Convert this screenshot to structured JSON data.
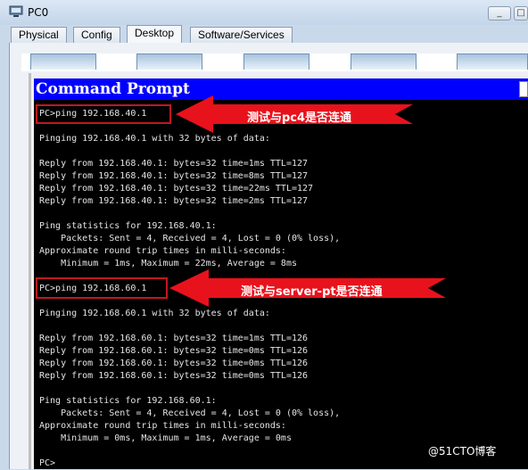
{
  "window": {
    "title": "PC0",
    "minimize": "_",
    "restore": "□"
  },
  "tabs": [
    {
      "label": "Physical"
    },
    {
      "label": "Config"
    },
    {
      "label": "Desktop"
    },
    {
      "label": "Software/Services"
    }
  ],
  "command_prompt": {
    "title": "Command Prompt"
  },
  "terminal": {
    "lines": [
      "PC>ping 192.168.40.1",
      "",
      "Pinging 192.168.40.1 with 32 bytes of data:",
      "",
      "Reply from 192.168.40.1: bytes=32 time=1ms TTL=127",
      "Reply from 192.168.40.1: bytes=32 time=8ms TTL=127",
      "Reply from 192.168.40.1: bytes=32 time=22ms TTL=127",
      "Reply from 192.168.40.1: bytes=32 time=2ms TTL=127",
      "",
      "Ping statistics for 192.168.40.1:",
      "    Packets: Sent = 4, Received = 4, Lost = 0 (0% loss),",
      "Approximate round trip times in milli-seconds:",
      "    Minimum = 1ms, Maximum = 22ms, Average = 8ms",
      "",
      "PC>ping 192.168.60.1",
      "",
      "Pinging 192.168.60.1 with 32 bytes of data:",
      "",
      "Reply from 192.168.60.1: bytes=32 time=1ms TTL=126",
      "Reply from 192.168.60.1: bytes=32 time=0ms TTL=126",
      "Reply from 192.168.60.1: bytes=32 time=0ms TTL=126",
      "Reply from 192.168.60.1: bytes=32 time=0ms TTL=126",
      "",
      "Ping statistics for 192.168.60.1:",
      "    Packets: Sent = 4, Received = 4, Lost = 0 (0% loss),",
      "Approximate round trip times in milli-seconds:",
      "    Minimum = 0ms, Maximum = 1ms, Average = 0ms",
      "",
      "PC>"
    ]
  },
  "annotations": [
    {
      "label": "测试与pc4是否连通"
    },
    {
      "label": "测试与server-pt是否连通"
    }
  ],
  "watermark": "@51CTO博客",
  "colors": {
    "prompt_title_bg": "#0000ff",
    "terminal_bg": "#000000",
    "annotation": "#e8121c"
  }
}
